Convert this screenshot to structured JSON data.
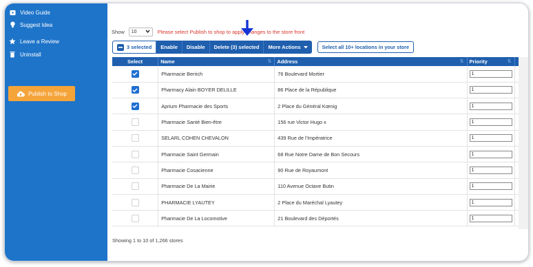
{
  "sidebar": {
    "items": [
      {
        "label": "Video Guide",
        "icon": "video-icon"
      },
      {
        "label": "Suggest Idea",
        "icon": "lightbulb-icon"
      },
      {
        "label": "Leave a Review",
        "icon": "star-icon"
      },
      {
        "label": "Uninstall",
        "icon": "trash-icon"
      }
    ],
    "publish_label": "Publish to Shop"
  },
  "toolbar": {
    "show_label": "Show",
    "show_value": "10",
    "warning": "Please select Publish to shop to apply changes to the store front",
    "selected_label": "3 selected",
    "enable_label": "Enable",
    "disable_label": "Disable",
    "delete_label": "Delete (3) selected",
    "more_label": "More Actions",
    "select_all_label": "Select all 10+ locations in your store"
  },
  "table": {
    "headers": {
      "select": "Select",
      "name": "Name",
      "address": "Address",
      "priority": "Priority"
    },
    "rows": [
      {
        "checked": true,
        "name": "Pharmacie Berrich",
        "address": "76 Boulevard Mortier",
        "priority": "1"
      },
      {
        "checked": true,
        "name": "Pharmacy Alain BOYER DELILLE",
        "address": "86 Place de la République",
        "priority": "1"
      },
      {
        "checked": true,
        "name": "Aprium Pharmacie des Sports",
        "address": "2 Place du Général Kœnig",
        "priority": "1"
      },
      {
        "checked": false,
        "name": "Pharmacie Santé Bien-être",
        "address": "156 rue Victor Hugo x",
        "priority": "1"
      },
      {
        "checked": false,
        "name": "SELARL COHEN CHEVALON",
        "address": "439 Rue de l'Impératrice",
        "priority": "1"
      },
      {
        "checked": false,
        "name": "Pharmacie Saint Germain",
        "address": "68 Rue Notre Dame de Bon Secours",
        "priority": "1"
      },
      {
        "checked": false,
        "name": "Pharmacie Cosacienne",
        "address": "90 Rue de Royaumont",
        "priority": "1"
      },
      {
        "checked": false,
        "name": "Pharmacie De La Mairie",
        "address": "110 Avenue Octave Butin",
        "priority": "1"
      },
      {
        "checked": false,
        "name": "PHARMACIE LYAUTEY",
        "address": "2 Place du Maréchal Lyautey",
        "priority": "1"
      },
      {
        "checked": false,
        "name": "Pharmacie De La Locomotive",
        "address": "21 Boulevard des Déportés",
        "priority": "1"
      }
    ]
  },
  "footer": {
    "text": "Showing 1 to 10 of 1,266 stores"
  },
  "colors": {
    "sidebar": "#1e74c9",
    "primary": "#1f5fae",
    "publish": "#f5a43a",
    "warning": "#d9342b",
    "arrow": "#1434d6"
  }
}
